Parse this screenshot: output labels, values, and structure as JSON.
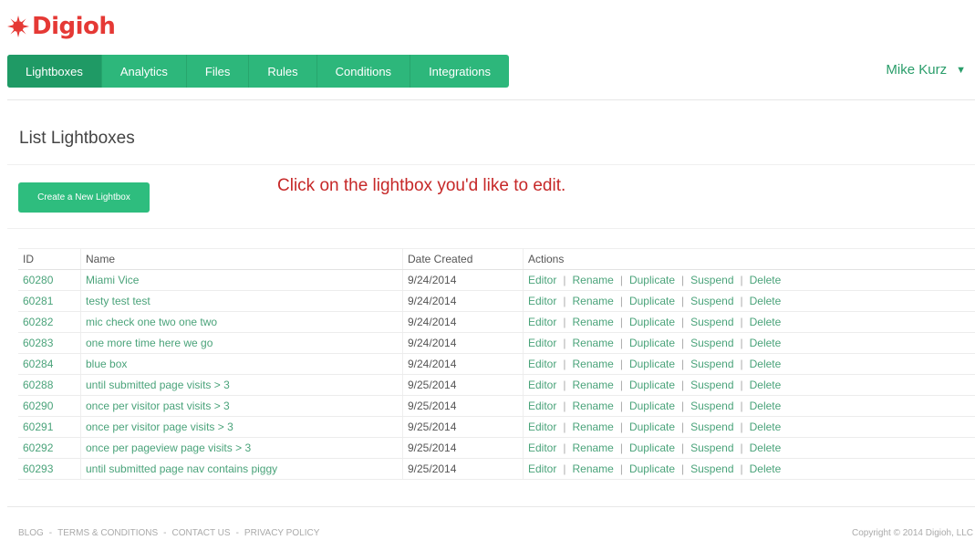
{
  "brand": {
    "name": "Digioh",
    "color": "#e53935",
    "icon": "sunburst-logo-icon"
  },
  "nav": {
    "items": [
      {
        "label": "Lightboxes",
        "active": true
      },
      {
        "label": "Analytics"
      },
      {
        "label": "Files"
      },
      {
        "label": "Rules"
      },
      {
        "label": "Conditions"
      },
      {
        "label": "Integrations"
      }
    ],
    "accent": "#2db77b"
  },
  "user": {
    "name": "Mike Kurz",
    "icon": "caret-down-icon"
  },
  "page": {
    "title": "List Lightboxes",
    "create_label": "Create a New Lightbox",
    "hint": "Click on the lightbox you'd like to edit."
  },
  "table": {
    "headers": {
      "id": "ID",
      "name": "Name",
      "date": "Date Created",
      "actions": "Actions"
    },
    "action_labels": [
      "Editor",
      "Rename",
      "Duplicate",
      "Suspend",
      "Delete"
    ],
    "rows": [
      {
        "id": "60280",
        "name": "Miami Vice",
        "date": "9/24/2014"
      },
      {
        "id": "60281",
        "name": "testy test test",
        "date": "9/24/2014"
      },
      {
        "id": "60282",
        "name": "mic check one two one two",
        "date": "9/24/2014"
      },
      {
        "id": "60283",
        "name": "one more time here we go",
        "date": "9/24/2014"
      },
      {
        "id": "60284",
        "name": "blue box",
        "date": "9/24/2014"
      },
      {
        "id": "60288",
        "name": "until submitted page visits > 3",
        "date": "9/25/2014"
      },
      {
        "id": "60290",
        "name": "once per visitor past visits > 3",
        "date": "9/25/2014"
      },
      {
        "id": "60291",
        "name": "once per visitor page visits > 3",
        "date": "9/25/2014"
      },
      {
        "id": "60292",
        "name": "once per pageview page visits > 3",
        "date": "9/25/2014"
      },
      {
        "id": "60293",
        "name": "until submitted page nav contains piggy",
        "date": "9/25/2014"
      }
    ]
  },
  "footer": {
    "links": [
      "BLOG",
      "TERMS & CONDITIONS",
      "CONTACT US",
      "PRIVACY POLICY"
    ],
    "copyright": "Copyright © 2014 Digioh, LLC"
  }
}
